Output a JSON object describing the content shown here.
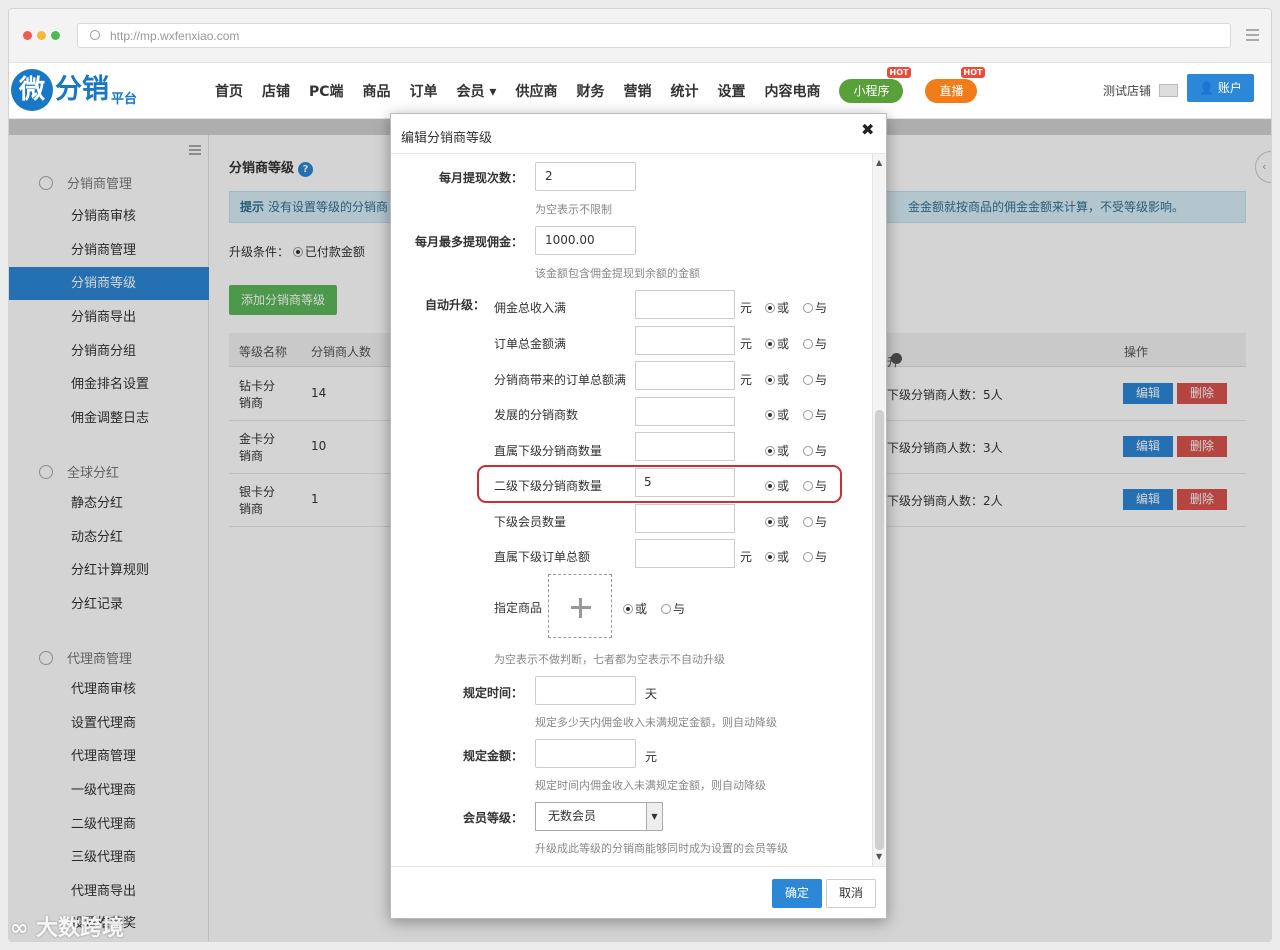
{
  "browser": {
    "url": "http://mp.wxfenxiao.com"
  },
  "logo": {
    "mark": "微",
    "name": "分销",
    "sub": "平台"
  },
  "nav": {
    "items": [
      "首页",
      "店铺",
      "PC端",
      "商品",
      "订单",
      "会员 ▾",
      "供应商",
      "财务",
      "营销",
      "统计",
      "设置",
      "内容电商"
    ],
    "mini_program": "小程序",
    "live": "直播",
    "hot": "HOT",
    "store": "测试店铺",
    "account": "账户"
  },
  "sidebar": {
    "sections": [
      {
        "title": "分销商管理",
        "items": [
          "分销商审核",
          "分销商管理",
          "分销商等级",
          "分销商导出",
          "分销商分组",
          "佣金排名设置",
          "佣金调整日志"
        ]
      },
      {
        "title": "全球分红",
        "items": [
          "静态分红",
          "动态分红",
          "分红计算规则",
          "分红记录"
        ]
      },
      {
        "title": "代理商管理",
        "items": [
          "代理商审核",
          "设置代理商",
          "代理商管理",
          "一级代理商",
          "二级代理商",
          "三级代理商",
          "代理商导出",
          "设置推荐奖"
        ]
      }
    ],
    "active": "分销商等级"
  },
  "page": {
    "title": "分销商等级",
    "tip_label": "提示",
    "tip_text": "没有设置等级的分销商",
    "tip_tail": "金金额就按商品的佣金金额来计算，不受等级影响。",
    "condition_label": "升级条件：",
    "condition_value": "已付款金额",
    "add_button": "添加分销商等级",
    "table": {
      "headers": [
        "等级名称",
        "分销商人数",
        "升级",
        "操作"
      ],
      "rows": [
        {
          "name": "钻卡分销商",
          "count": "14",
          "upgrade": "下级分销商人数：5人"
        },
        {
          "name": "金卡分销商",
          "count": "10",
          "upgrade": "下级分销商人数：3人"
        },
        {
          "name": "银卡分销商",
          "count": "1",
          "upgrade": "下级分销商人数：2人"
        }
      ],
      "edit": "编辑",
      "delete": "删除"
    }
  },
  "modal": {
    "title": "编辑分销商等级",
    "close": "✖",
    "withdraw_times_label": "每月提现次数：",
    "withdraw_times_value": "2",
    "withdraw_times_hint": "为空表示不限制",
    "max_withdraw_label": "每月最多提现佣金：",
    "max_withdraw_value": "1000.00",
    "max_withdraw_hint": "该金额包含佣金提现到余额的金额",
    "auto_upgrade_label": "自动升级：",
    "conditions": [
      {
        "label": "佣金总收入满",
        "value": "",
        "unit": "元"
      },
      {
        "label": "订单总金额满",
        "value": "",
        "unit": "元"
      },
      {
        "label": "分销商带来的订单总额满",
        "value": "",
        "unit": "元"
      },
      {
        "label": "发展的分销商数",
        "value": "",
        "unit": ""
      },
      {
        "label": "直属下级分销商数量",
        "value": "",
        "unit": ""
      },
      {
        "label": "二级下级分销商数量",
        "value": "5",
        "unit": ""
      },
      {
        "label": "下级会员数量",
        "value": "",
        "unit": ""
      },
      {
        "label": "直属下级订单总额",
        "value": "",
        "unit": "元"
      }
    ],
    "or_label": "或",
    "and_label": "与",
    "product_label": "指定商品",
    "conditions_hint": "为空表示不做判断，七者都为空表示不自动升级",
    "time_label": "规定时间：",
    "time_unit": "天",
    "time_hint": "规定多少天内佣金收入未满规定金额，则自动降级",
    "amount_label": "规定金额：",
    "amount_unit": "元",
    "amount_hint": "规定时间内佣金收入未满规定金额，则自动降级",
    "member_label": "会员等级：",
    "member_value": "无数会员",
    "member_hint": "升级成此等级的分销商能够同时成为设置的会员等级",
    "ok": "确定",
    "cancel": "取消"
  },
  "watermark": "大数跨境"
}
